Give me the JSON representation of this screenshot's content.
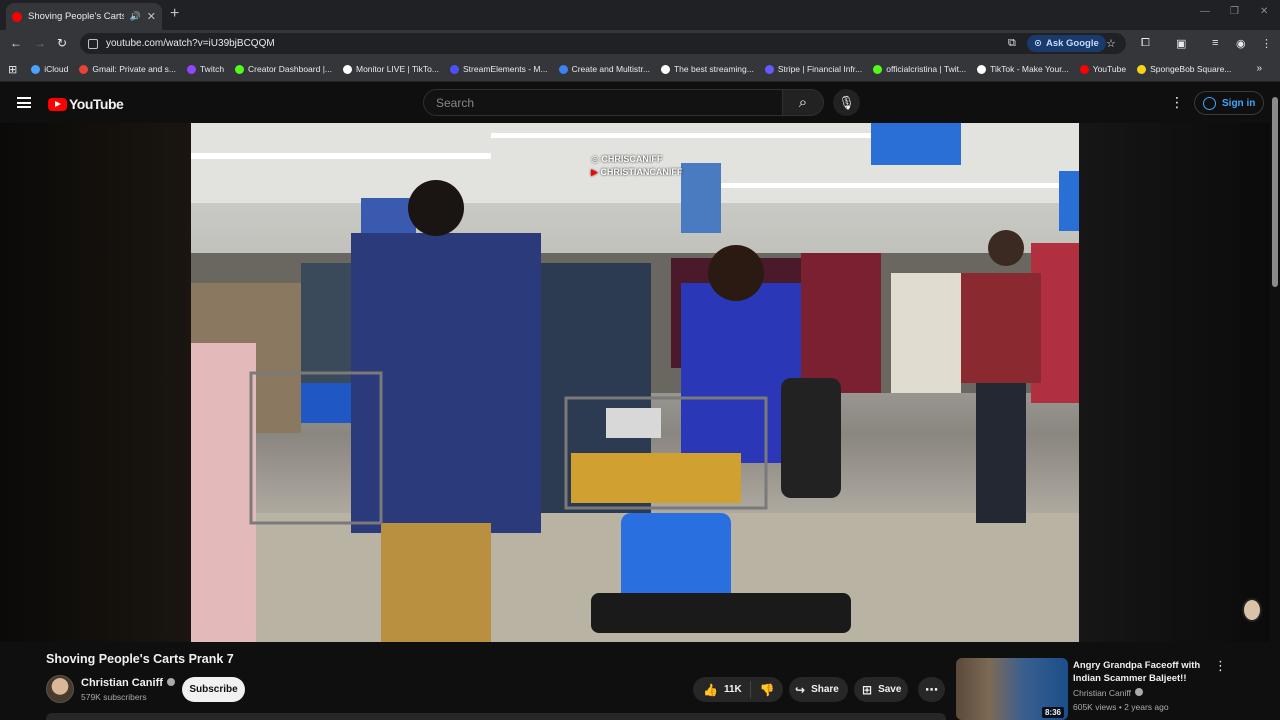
{
  "browser": {
    "tab_title": "Shoving People's Carts Prank",
    "url": "youtube.com/watch?v=iU39bjBCQQM",
    "ask_google": "Ask Google",
    "bookmarks": [
      {
        "label": "iCloud",
        "color": "#4aa3ff"
      },
      {
        "label": "Gmail: Private and s...",
        "color": "#ea4335"
      },
      {
        "label": "Twitch",
        "color": "#9146ff"
      },
      {
        "label": "Creator Dashboard |...",
        "color": "#53fc18"
      },
      {
        "label": "Monitor LIVE | TikTo...",
        "color": "#ffffff"
      },
      {
        "label": "StreamElements - M...",
        "color": "#4f4fff"
      },
      {
        "label": "Create and Multistr...",
        "color": "#3b82f6"
      },
      {
        "label": "The best streaming...",
        "color": "#ffffff"
      },
      {
        "label": "Stripe | Financial Infr...",
        "color": "#635bff"
      },
      {
        "label": "officialcristina | Twit...",
        "color": "#53fc18"
      },
      {
        "label": "TikTok - Make Your...",
        "color": "#ffffff"
      },
      {
        "label": "YouTube",
        "color": "#ff0000"
      },
      {
        "label": "SpongeBob Square...",
        "color": "#f5d31b"
      }
    ]
  },
  "youtube": {
    "logo_text": "YouTube",
    "search_placeholder": "Search",
    "sign_in": "Sign in"
  },
  "video": {
    "watermark_ig": "CHRISCANIFF",
    "watermark_yt": "CHRISTIANCANIFF",
    "title": "Shoving People's Carts Prank 7",
    "channel": "Christian Caniff",
    "subscribers": "579K subscribers",
    "subscribe_label": "Subscribe",
    "likes": "11K",
    "share_label": "Share",
    "save_label": "Save"
  },
  "recommendation": {
    "title": "Angry Grandpa Faceoff with Indian Scammer Baljeet!!",
    "channel": "Christian Caniff",
    "meta": "605K views • 2 years ago",
    "duration": "8:36"
  }
}
